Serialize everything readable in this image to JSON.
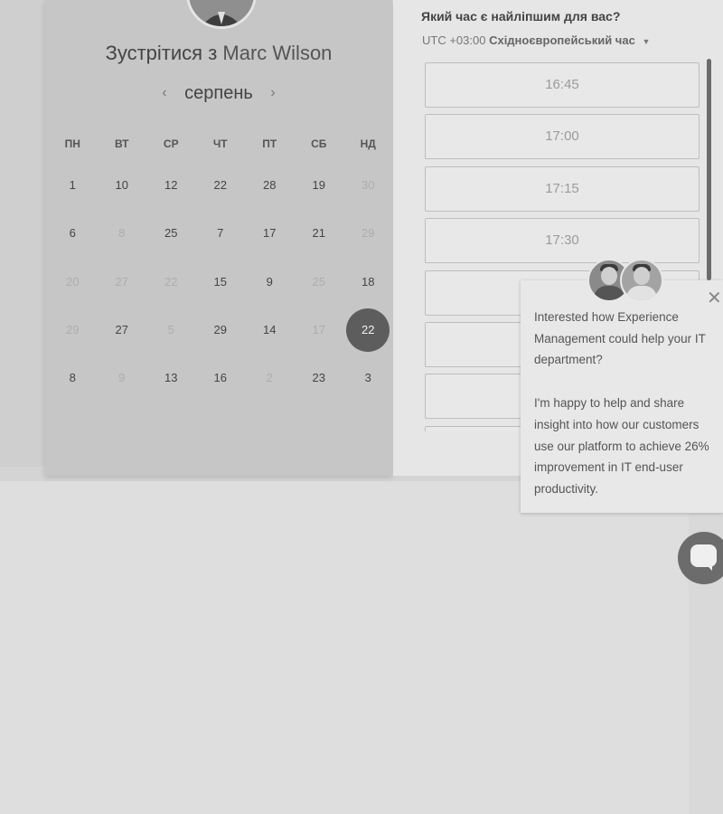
{
  "calendar": {
    "title_prefix": "Зустрітися з",
    "host_name": "Marc Wilson",
    "month": "серпень",
    "prev_arrow": "‹",
    "next_arrow": "›",
    "weekdays": [
      "ПН",
      "ВТ",
      "СР",
      "ЧТ",
      "ПТ",
      "СБ",
      "НД"
    ],
    "days": [
      {
        "label": "1",
        "state": "available"
      },
      {
        "label": "10",
        "state": "available"
      },
      {
        "label": "12",
        "state": "available"
      },
      {
        "label": "22",
        "state": "available"
      },
      {
        "label": "28",
        "state": "available"
      },
      {
        "label": "19",
        "state": "available"
      },
      {
        "label": "30",
        "state": "disabled"
      },
      {
        "label": "6",
        "state": "available"
      },
      {
        "label": "8",
        "state": "disabled"
      },
      {
        "label": "25",
        "state": "available"
      },
      {
        "label": "7",
        "state": "available"
      },
      {
        "label": "17",
        "state": "available"
      },
      {
        "label": "21",
        "state": "available"
      },
      {
        "label": "29",
        "state": "disabled"
      },
      {
        "label": "20",
        "state": "disabled"
      },
      {
        "label": "27",
        "state": "disabled"
      },
      {
        "label": "22",
        "state": "disabled"
      },
      {
        "label": "15",
        "state": "available"
      },
      {
        "label": "9",
        "state": "available"
      },
      {
        "label": "25",
        "state": "disabled"
      },
      {
        "label": "18",
        "state": "available"
      },
      {
        "label": "29",
        "state": "disabled"
      },
      {
        "label": "27",
        "state": "available"
      },
      {
        "label": "5",
        "state": "disabled"
      },
      {
        "label": "29",
        "state": "available"
      },
      {
        "label": "14",
        "state": "available"
      },
      {
        "label": "17",
        "state": "disabled"
      },
      {
        "label": "22",
        "state": "selected"
      },
      {
        "label": "8",
        "state": "available"
      },
      {
        "label": "9",
        "state": "disabled"
      },
      {
        "label": "13",
        "state": "available"
      },
      {
        "label": "16",
        "state": "available"
      },
      {
        "label": "2",
        "state": "disabled"
      },
      {
        "label": "23",
        "state": "available"
      },
      {
        "label": "3",
        "state": "available"
      }
    ]
  },
  "times": {
    "question": "Який час є найліпшим для вас?",
    "timezone_offset": "UTC +03:00",
    "timezone_name": "Східноєвропейський час",
    "slots": [
      "16:45",
      "17:00",
      "17:15",
      "17:30",
      "",
      "",
      "",
      ""
    ]
  },
  "chat": {
    "message_line1": "Interested how Experience Management could help your IT department?",
    "message_line2": "I'm happy to help and share insight into how our customers use our platform to achieve 26% improvement in IT end-user productivity.",
    "close_glyph": "✕",
    "icons": {
      "close": "close-icon",
      "launcher": "chat-bubble-icon"
    }
  },
  "colors": {
    "selected_day": "#5d5d5d",
    "panel": "#c6c6c6",
    "slot_border": "#bdbdbd"
  }
}
